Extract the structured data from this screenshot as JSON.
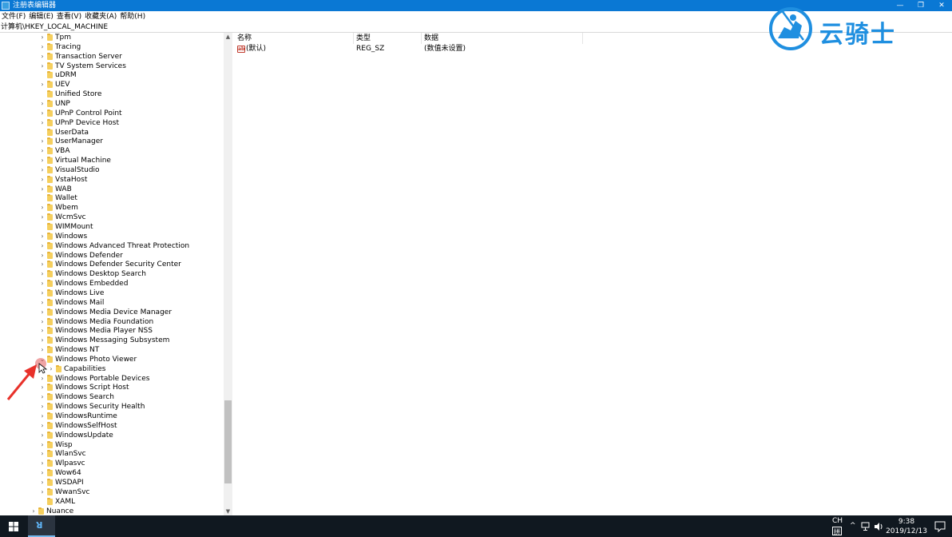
{
  "window": {
    "title": "注册表编辑器",
    "controls": [
      "—",
      "❐",
      "✕"
    ]
  },
  "menu": [
    "文件(F)",
    "编辑(E)",
    "查看(V)",
    "收藏夹(A)",
    "帮助(H)"
  ],
  "address": "计算机\\HKEY_LOCAL_MACHINE",
  "tree": [
    {
      "label": "Tpm",
      "depth": 2,
      "expandable": true
    },
    {
      "label": "Tracing",
      "depth": 2,
      "expandable": true
    },
    {
      "label": "Transaction Server",
      "depth": 2,
      "expandable": true
    },
    {
      "label": "TV System Services",
      "depth": 2,
      "expandable": true
    },
    {
      "label": "uDRM",
      "depth": 2,
      "expandable": false
    },
    {
      "label": "UEV",
      "depth": 2,
      "expandable": true
    },
    {
      "label": "Unified Store",
      "depth": 2,
      "expandable": false
    },
    {
      "label": "UNP",
      "depth": 2,
      "expandable": true
    },
    {
      "label": "UPnP Control Point",
      "depth": 2,
      "expandable": true
    },
    {
      "label": "UPnP Device Host",
      "depth": 2,
      "expandable": true
    },
    {
      "label": "UserData",
      "depth": 2,
      "expandable": false
    },
    {
      "label": "UserManager",
      "depth": 2,
      "expandable": true
    },
    {
      "label": "VBA",
      "depth": 2,
      "expandable": true
    },
    {
      "label": "Virtual Machine",
      "depth": 2,
      "expandable": true
    },
    {
      "label": "VisualStudio",
      "depth": 2,
      "expandable": true
    },
    {
      "label": "VstaHost",
      "depth": 2,
      "expandable": true
    },
    {
      "label": "WAB",
      "depth": 2,
      "expandable": true
    },
    {
      "label": "Wallet",
      "depth": 2,
      "expandable": false
    },
    {
      "label": "Wbem",
      "depth": 2,
      "expandable": true
    },
    {
      "label": "WcmSvc",
      "depth": 2,
      "expandable": true
    },
    {
      "label": "WIMMount",
      "depth": 2,
      "expandable": false
    },
    {
      "label": "Windows",
      "depth": 2,
      "expandable": true
    },
    {
      "label": "Windows Advanced Threat Protection",
      "depth": 2,
      "expandable": true
    },
    {
      "label": "Windows Defender",
      "depth": 2,
      "expandable": true
    },
    {
      "label": "Windows Defender Security Center",
      "depth": 2,
      "expandable": true
    },
    {
      "label": "Windows Desktop Search",
      "depth": 2,
      "expandable": true
    },
    {
      "label": "Windows Embedded",
      "depth": 2,
      "expandable": true
    },
    {
      "label": "Windows Live",
      "depth": 2,
      "expandable": true
    },
    {
      "label": "Windows Mail",
      "depth": 2,
      "expandable": true
    },
    {
      "label": "Windows Media Device Manager",
      "depth": 2,
      "expandable": true
    },
    {
      "label": "Windows Media Foundation",
      "depth": 2,
      "expandable": true
    },
    {
      "label": "Windows Media Player NSS",
      "depth": 2,
      "expandable": true
    },
    {
      "label": "Windows Messaging Subsystem",
      "depth": 2,
      "expandable": true
    },
    {
      "label": "Windows NT",
      "depth": 2,
      "expandable": true
    },
    {
      "label": "Windows Photo Viewer",
      "depth": 2,
      "expandable": true,
      "expanded": true
    },
    {
      "label": "Capabilities",
      "depth": 3,
      "expandable": true
    },
    {
      "label": "Windows Portable Devices",
      "depth": 2,
      "expandable": true
    },
    {
      "label": "Windows Script Host",
      "depth": 2,
      "expandable": true
    },
    {
      "label": "Windows Search",
      "depth": 2,
      "expandable": true
    },
    {
      "label": "Windows Security Health",
      "depth": 2,
      "expandable": true
    },
    {
      "label": "WindowsRuntime",
      "depth": 2,
      "expandable": true
    },
    {
      "label": "WindowsSelfHost",
      "depth": 2,
      "expandable": true
    },
    {
      "label": "WindowsUpdate",
      "depth": 2,
      "expandable": true
    },
    {
      "label": "Wisp",
      "depth": 2,
      "expandable": true
    },
    {
      "label": "WlanSvc",
      "depth": 2,
      "expandable": true
    },
    {
      "label": "Wlpasvc",
      "depth": 2,
      "expandable": true
    },
    {
      "label": "Wow64",
      "depth": 2,
      "expandable": true
    },
    {
      "label": "WSDAPI",
      "depth": 2,
      "expandable": true
    },
    {
      "label": "WwanSvc",
      "depth": 2,
      "expandable": true
    },
    {
      "label": "XAML",
      "depth": 2,
      "expandable": false
    },
    {
      "label": "Nuance",
      "depth": 1,
      "expandable": true
    }
  ],
  "list": {
    "columns": [
      "名称",
      "类型",
      "数据"
    ],
    "rows": [
      {
        "name": "(默认)",
        "type": "REG_SZ",
        "data": "(数值未设置)",
        "icon": "string-value-icon",
        "icon_text": "ab"
      }
    ]
  },
  "taskbar": {
    "language": "CH",
    "ime": "拼",
    "time": "9:38",
    "date": "2019/12/13",
    "app_glyph": "ꓤ"
  },
  "logo": {
    "text": "云骑士",
    "color": "#1f8fe0"
  },
  "colors": {
    "titlebar": "#0a78d4",
    "taskbar": "#101820",
    "folder": "#f5cf5e",
    "annotation_arrow": "#e8312a"
  }
}
